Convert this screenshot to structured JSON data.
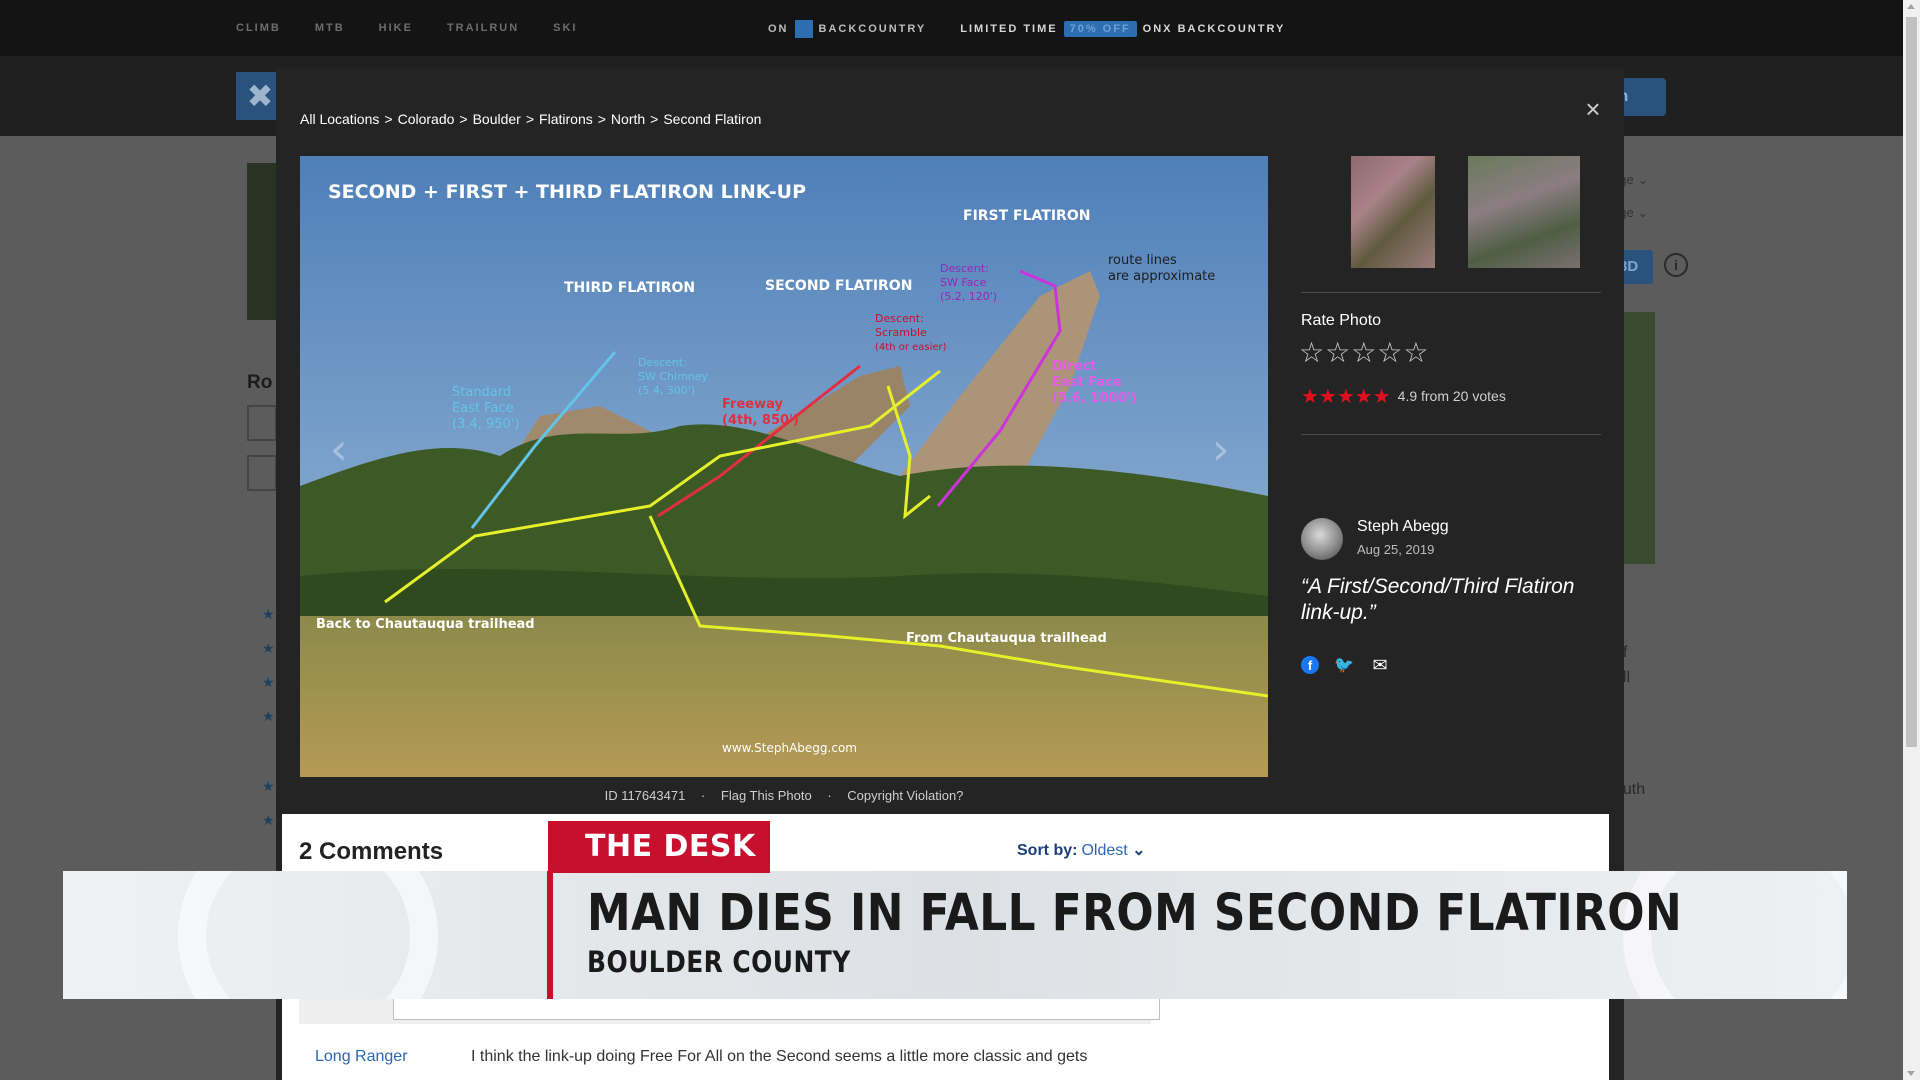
{
  "topnav": {
    "links": [
      "CLIMB",
      "MTB",
      "HIKE",
      "TRAILRUN",
      "SKI"
    ],
    "promo_prefix": "ON",
    "promo_brand": "BACKCOUNTRY",
    "limited": "LIMITED TIME",
    "off_pill": "70% OFF",
    "promo_suffix": "ONX BACKCOUNTRY"
  },
  "background": {
    "signin_label": "In",
    "route_heading": "Ro",
    "btn_3d": "3D",
    "info_icon": "i",
    "page_label_1": "age",
    "page_label_2": "age",
    "text_1": "of",
    "text_2": "ell",
    "text_3": "outh"
  },
  "modal": {
    "close_label": "×",
    "breadcrumb": [
      {
        "label": "All Locations"
      },
      {
        "label": "Colorado"
      },
      {
        "label": "Boulder"
      },
      {
        "label": "Flatirons"
      },
      {
        "label": "North"
      },
      {
        "label": "Second Flatiron"
      }
    ],
    "separator": ">",
    "photo": {
      "title": "SECOND + FIRST + THIRD FLATIRON LINK-UP",
      "labels": {
        "first": "FIRST FLATIRON",
        "second": "SECOND FLATIRON",
        "third": "THIRD FLATIRON",
        "note_1": "route lines",
        "note_2": "are approximate",
        "std_1": "Standard",
        "std_2": "East Face",
        "std_3": "(3.4, 950')",
        "sw_1": "Descent:",
        "sw_2": "SW Chimney",
        "sw_3": "(5.4, 300')",
        "fw_1": "Freeway",
        "fw_2": "(4th, 850')",
        "sc_1": "Descent:",
        "sc_2": "Scramble",
        "sc_3": "(4th or easier)",
        "swf_1": "Descent:",
        "swf_2": "SW Face",
        "swf_3": "(5.2, 120')",
        "df_1": "Direct",
        "df_2": "East Face",
        "df_3": "(5.6, 1000')",
        "back": "Back to Chautauqua trailhead",
        "from": "From Chautauqua trailhead",
        "credit": "www.StephAbegg.com"
      },
      "prev_arrow": "‹",
      "next_arrow": "›"
    },
    "meta": {
      "id": "ID 117643471",
      "dot": "·",
      "flag": "Flag This Photo",
      "copyright": "Copyright Violation?"
    },
    "rate_title": "Rate Photo",
    "rate_stars": "☆☆☆☆☆",
    "score_stars": "★★★★★",
    "score_text": "4.9 from 20 votes",
    "score_value": 4.9,
    "author": "Steph Abegg",
    "date": "Aug 25, 2019",
    "caption": "“A First/Second/Third Flatiron link-up.”",
    "share_icons": [
      "facebook-icon",
      "twitter-icon",
      "email-icon"
    ],
    "share_glyphs": {
      "facebook": "f",
      "twitter": "🐦",
      "email": "✉"
    }
  },
  "comments": {
    "heading": "2 Comments",
    "sort_label": "Sort by:",
    "sort_value": "Oldest",
    "sort_chevron": "⌄",
    "first_author": "Long Ranger",
    "first_text": "I think the link-up doing Free For All on the Second seems a little more classic and gets"
  },
  "news_overlay": {
    "desk": "THE DESK",
    "headline": "MAN DIES IN FALL FROM SECOND FLATIRON",
    "subline": "BOULDER COUNTY",
    "accent_color": "#c8102e"
  },
  "colors": {
    "modal_bg": "#242424",
    "link_blue": "#2d66b3",
    "rating_red": "#e1101f"
  }
}
